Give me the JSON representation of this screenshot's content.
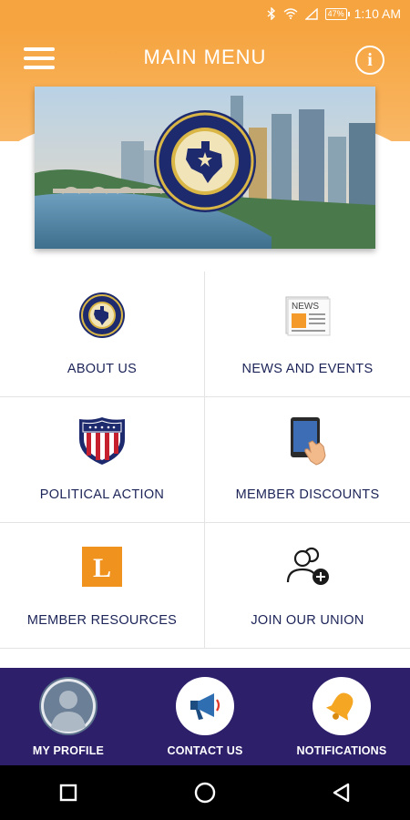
{
  "status_bar": {
    "battery": "47%",
    "time": "1:10 AM",
    "icons": [
      "bluetooth-icon",
      "wifi-icon",
      "cell-signal-icon",
      "battery-icon"
    ]
  },
  "header": {
    "title": "MAIN MENU",
    "menu_icon": "hamburger-menu-icon",
    "info_icon": "info-icon",
    "info_glyph": "i"
  },
  "banner": {
    "logo_text_top": "Laborers' Local 1095",
    "logo_text_bottom": "Central And Southeast Texas"
  },
  "menu": {
    "items": [
      {
        "label": "ABOUT US",
        "icon": "union-seal-icon"
      },
      {
        "label": "NEWS AND EVENTS",
        "icon": "newspaper-icon",
        "icon_text": "NEWS"
      },
      {
        "label": "POLITICAL ACTION",
        "icon": "shield-flag-icon"
      },
      {
        "label": "MEMBER DISCOUNTS",
        "icon": "tablet-touch-icon"
      },
      {
        "label": "MEMBER RESOURCES",
        "icon": "resources-l-icon",
        "icon_text": "L"
      },
      {
        "label": "JOIN OUR UNION",
        "icon": "add-user-icon"
      }
    ]
  },
  "bottom_nav": {
    "items": [
      {
        "label": "MY PROFILE",
        "icon": "avatar-icon"
      },
      {
        "label": "CONTACT US",
        "icon": "megaphone-icon"
      },
      {
        "label": "NOTIFICATIONS",
        "icon": "bell-icon"
      }
    ]
  },
  "colors": {
    "accent_orange": "#f6a43f",
    "navy": "#2e1f6b",
    "text_dark": "#1c2458"
  }
}
